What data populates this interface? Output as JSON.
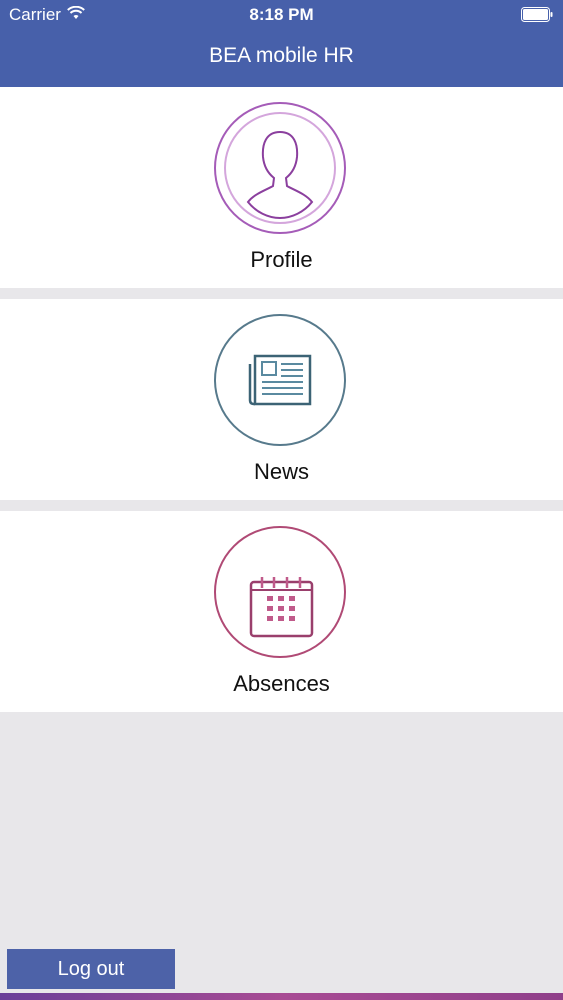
{
  "status_bar": {
    "carrier": "Carrier",
    "time": "8:18 PM",
    "icons": [
      "wifi-icon",
      "battery-icon"
    ]
  },
  "header": {
    "title": "BEA mobile HR",
    "color": "#4760aa"
  },
  "menu": [
    {
      "label": "Profile",
      "icon": "person-icon",
      "color": "#a55cb8"
    },
    {
      "label": "News",
      "icon": "newspaper-icon",
      "color": "#577a8c"
    },
    {
      "label": "Absences",
      "icon": "calendar-icon",
      "color": "#b04a75"
    }
  ],
  "logout": {
    "label": "Log out",
    "color": "#4d62a8"
  }
}
